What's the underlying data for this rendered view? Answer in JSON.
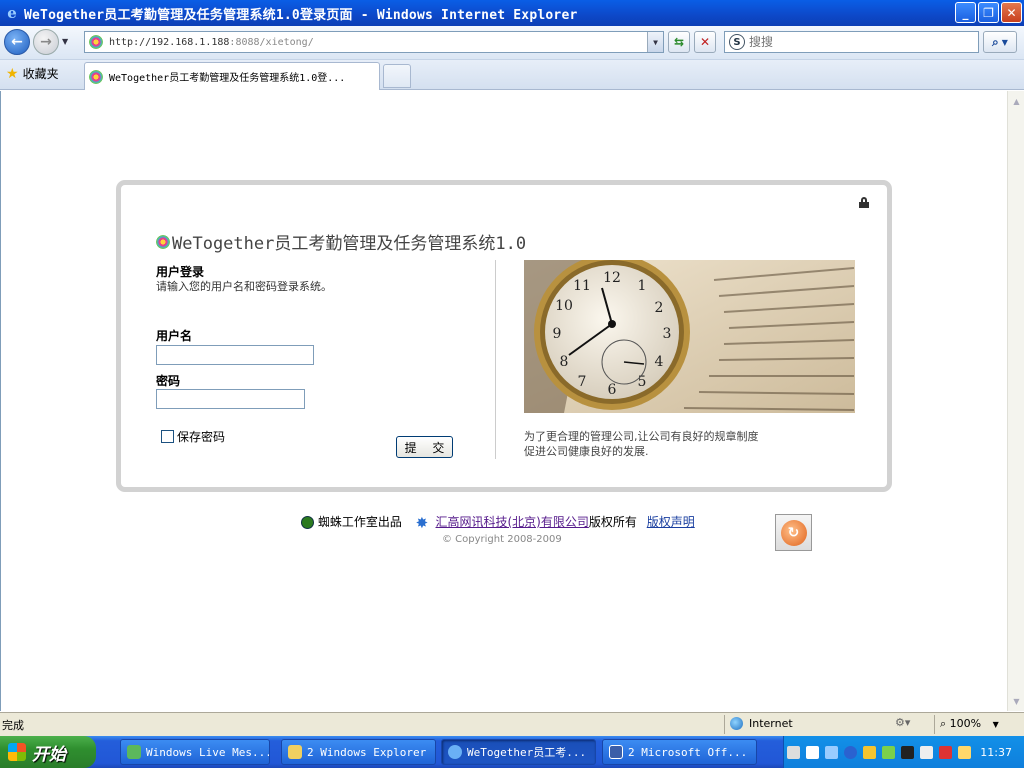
{
  "window": {
    "title": "WeTogether员工考勤管理及任务管理系统1.0登录页面 - Windows Internet Explorer",
    "minimize": "_",
    "restore": "❐",
    "close": "✕"
  },
  "nav": {
    "back": "←",
    "forward": "→",
    "address_main": "http://192.168.1.188",
    "address_rest": ":8088/xietong/",
    "refresh": "⇆",
    "stop": "✕",
    "search_placeholder": "搜搜",
    "search_btn": "⌕"
  },
  "tabs": {
    "favorites": "收藏夹",
    "active_tab": "WeTogether员工考勤管理及任务管理系统1.0登...",
    "new_tab": ""
  },
  "page": {
    "app_title": "WeTogether员工考勤管理及任务管理系统1.0",
    "login_heading": "用户登录",
    "login_subtitle": "请输入您的用户名和密码登录系统。",
    "username_label": "用户名",
    "username_value": "",
    "password_label": "密码",
    "password_value": "",
    "remember_label": "保存密码",
    "remember_checked": false,
    "submit_label": "提 交",
    "caption_line1": "为了更合理的管理公司,让公司有良好的规章制度",
    "caption_line2": "促进公司健康良好的发展."
  },
  "footer": {
    "studio": "蜘蛛工作室出品",
    "company_link": "汇高网讯科技(北京)有限公司",
    "rights": "版权所有",
    "copyright_link": "版权声明",
    "copyright": "© Copyright 2008-2009"
  },
  "status": {
    "text": "完成",
    "zone": "Internet",
    "zoom": "100%"
  },
  "taskbar": {
    "start": "开始",
    "items": [
      "Windows Live Mes...",
      "2 Windows Explorer",
      "WeTogether员工考...",
      "2 Microsoft Off..."
    ],
    "clock": "11:37"
  },
  "colors": {
    "title_blue": "#0d48c8",
    "card_border": "#d2d2d2",
    "taskbar_blue": "#245edb",
    "start_green": "#2f8f2f"
  }
}
